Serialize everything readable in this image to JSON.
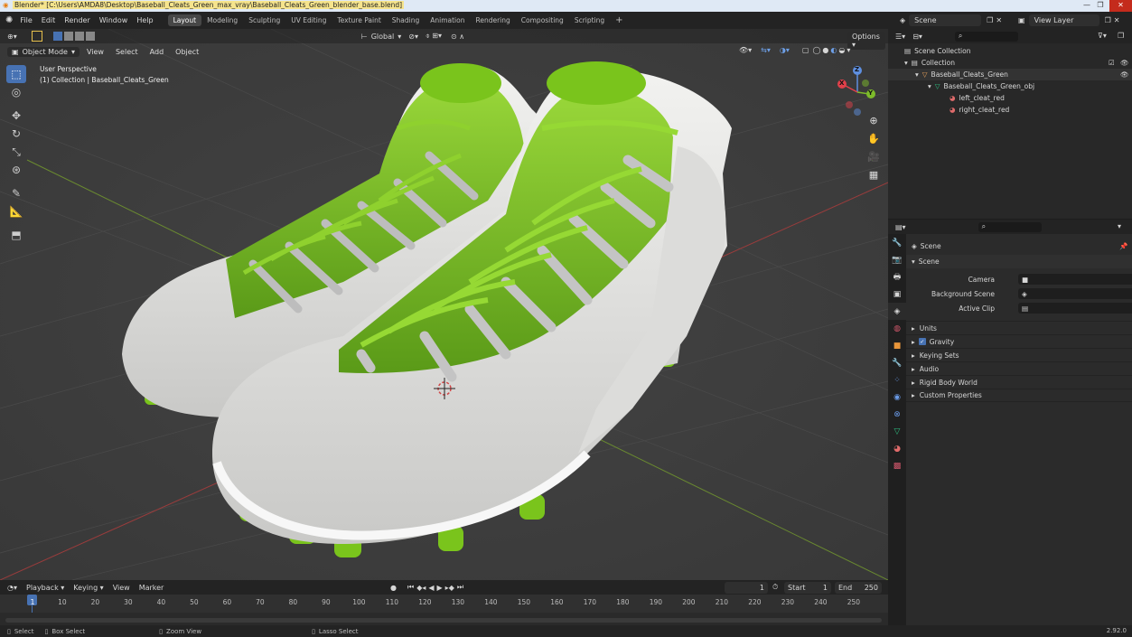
{
  "window": {
    "title": "Blender* [C:\\Users\\AMDA8\\Desktop\\Baseball_Cleats_Green_max_vray\\Baseball_Cleats_Green_blender_base.blend]",
    "min": "—",
    "max": "❐",
    "close": "✕"
  },
  "menu": [
    "File",
    "Edit",
    "Render",
    "Window",
    "Help"
  ],
  "workspaces": [
    "Layout",
    "Modeling",
    "Sculpting",
    "UV Editing",
    "Texture Paint",
    "Shading",
    "Animation",
    "Rendering",
    "Compositing",
    "Scripting"
  ],
  "active_workspace": "Layout",
  "scene_field": "Scene",
  "view_layer_field": "View Layer",
  "viewport": {
    "transform_orientation": "Global",
    "options_label": "Options",
    "mode": "Object Mode",
    "header_menu": [
      "View",
      "Select",
      "Add",
      "Object"
    ],
    "overlay_line1": "User Perspective",
    "overlay_line2": "(1) Collection | Baseball_Cleats_Green",
    "gizmo": {
      "x": "X",
      "y": "Y",
      "z": "Z"
    }
  },
  "outliner": {
    "root": "Scene Collection",
    "items": [
      {
        "label": "Collection",
        "type": "collection"
      },
      {
        "label": "Baseball_Cleats_Green",
        "type": "object"
      },
      {
        "label": "Baseball_Cleats_Green_obj",
        "type": "mesh"
      },
      {
        "label": "left_cleat_red",
        "type": "material"
      },
      {
        "label": "right_cleat_red",
        "type": "material"
      }
    ]
  },
  "properties": {
    "context": "Scene",
    "panel": "Scene",
    "fields": [
      {
        "label": "Camera",
        "value": ""
      },
      {
        "label": "Background Scene",
        "value": ""
      },
      {
        "label": "Active Clip",
        "value": ""
      }
    ],
    "sections": [
      "Units",
      "Gravity",
      "Keying Sets",
      "Audio",
      "Rigid Body World",
      "Custom Properties"
    ],
    "gravity_checked": true
  },
  "timeline": {
    "menu": [
      "Playback",
      "Keying",
      "View",
      "Marker"
    ],
    "current_frame": "1",
    "start_label": "Start",
    "start_value": "1",
    "end_label": "End",
    "end_value": "250",
    "ticks": [
      "1",
      "10",
      "20",
      "30",
      "40",
      "50",
      "60",
      "70",
      "80",
      "90",
      "100",
      "110",
      "120",
      "130",
      "140",
      "150",
      "160",
      "170",
      "180",
      "190",
      "200",
      "210",
      "220",
      "230",
      "240",
      "250"
    ]
  },
  "statusbar": {
    "select": "Select",
    "box_select": "Box Select",
    "zoom_view": "Zoom View",
    "lasso_select": "Lasso Select",
    "version": "2.92.0"
  },
  "colors": {
    "accent": "#4772b3",
    "shoe_green": "#7ac41c",
    "shoe_white": "#e6e6e4"
  }
}
